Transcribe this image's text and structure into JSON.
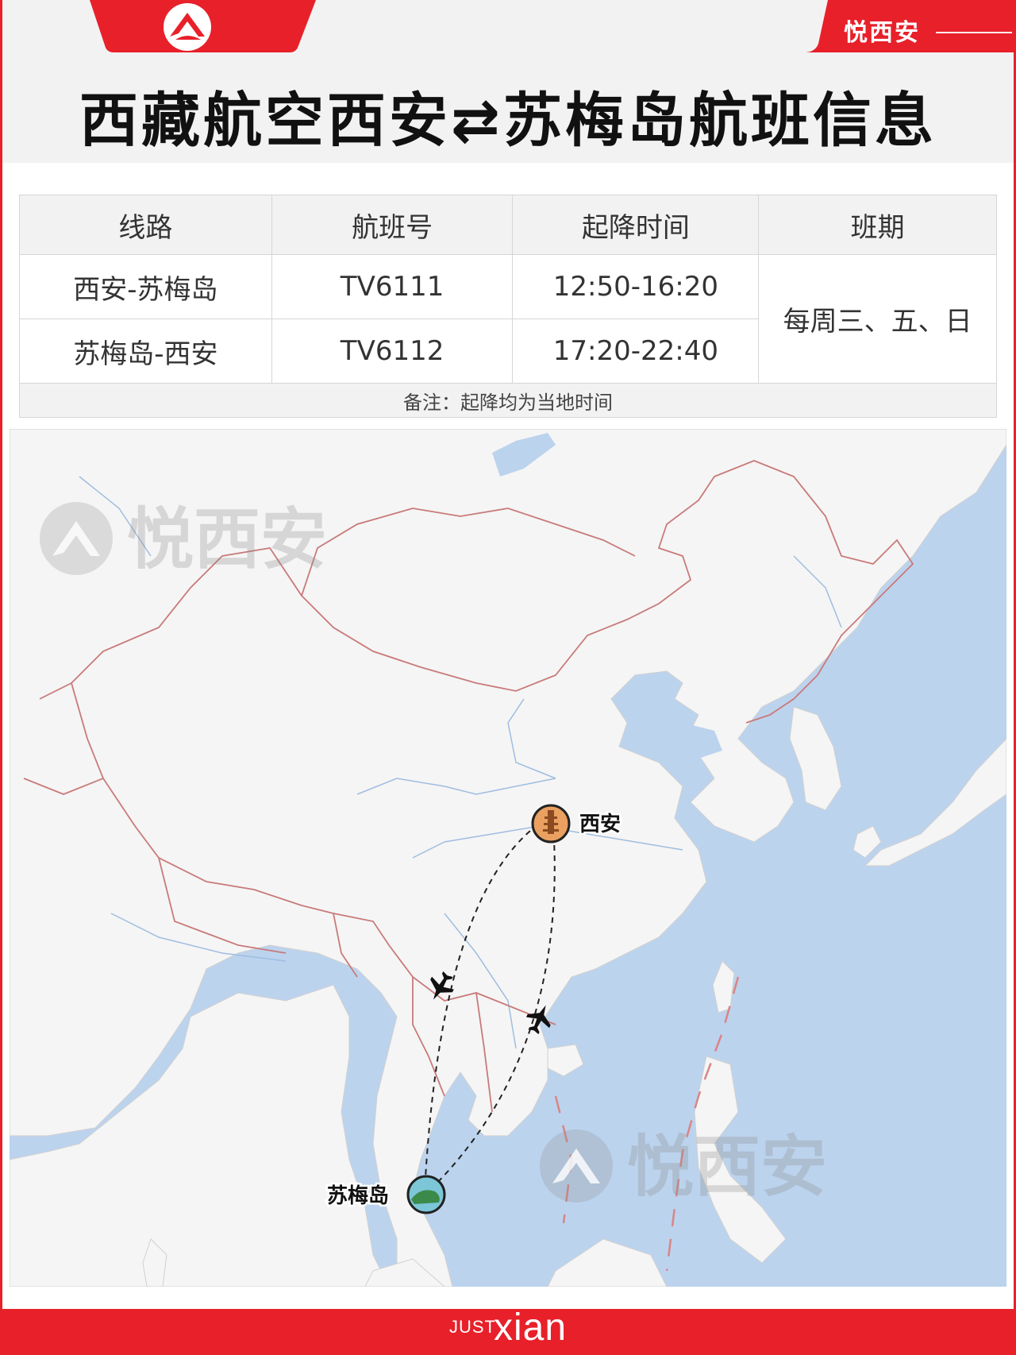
{
  "header": {
    "title": "西藏航空西安⇄苏梅岛航班信息",
    "brand": "悦西安",
    "logo_icon": "brand-logo-icon"
  },
  "table": {
    "headers": [
      "线路",
      "航班号",
      "起降时间",
      "班期"
    ],
    "rows": [
      {
        "route": "西安-苏梅岛",
        "flight": "TV6111",
        "time": "12:50-16:20"
      },
      {
        "route": "苏梅岛-西安",
        "flight": "TV6112",
        "time": "17:20-22:40"
      }
    ],
    "schedule": "每周三、五、日",
    "note": "备注：起降均为当地时间"
  },
  "map": {
    "origin_label": "西安",
    "destination_label": "苏梅岛",
    "watermark": "悦西安",
    "route_icon": "airplane-icon"
  },
  "footer": {
    "just": "JUST",
    "xian": "xian"
  },
  "colors": {
    "accent": "#e8202a",
    "land": "#f5f5f5",
    "sea": "#bcd3ee",
    "border": "#c97a7a"
  }
}
